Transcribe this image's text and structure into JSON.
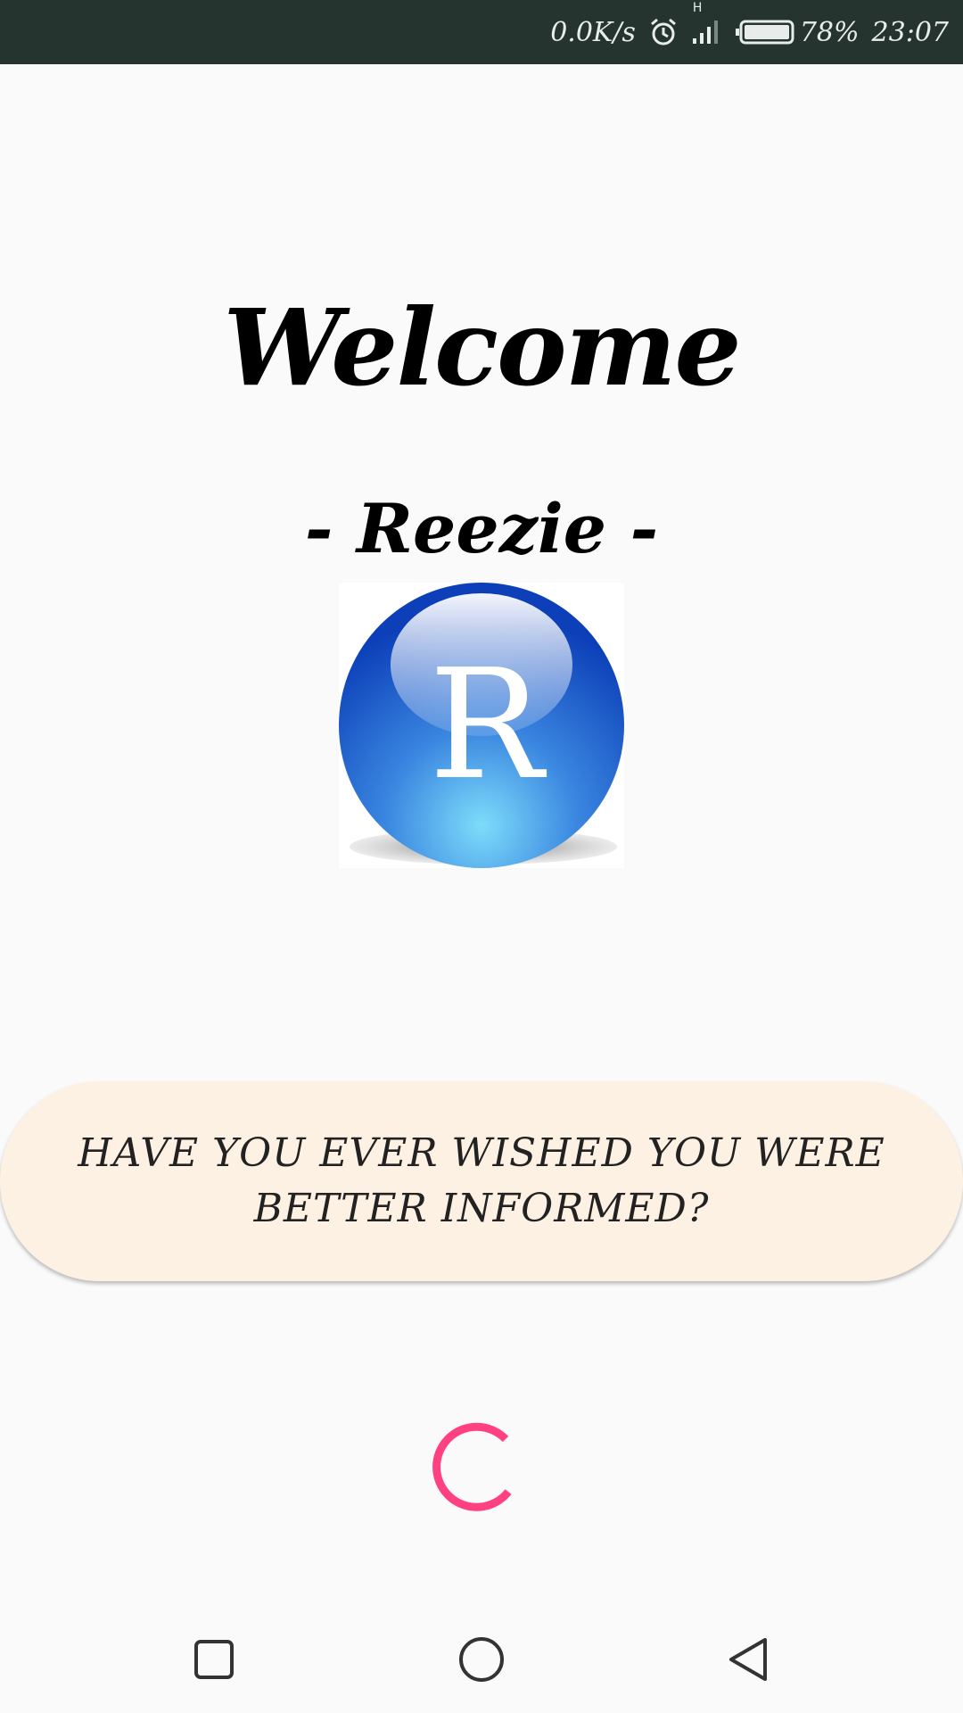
{
  "status_bar": {
    "net_speed": "0.0K/s",
    "network_type": "H",
    "battery_percent": "78%",
    "time": "23:07",
    "battery_level": 0.78,
    "icons": [
      "alarm-icon",
      "signal-icon",
      "battery-icon"
    ]
  },
  "welcome": {
    "title": "Welcome",
    "app_name": "- Reezie -"
  },
  "logo": {
    "letter": "R",
    "icon": "r-sphere-logo"
  },
  "tagline": {
    "text": "HAVE YOU EVER WISHED YOU WERE BETTER INFORMED?"
  },
  "loader": {
    "color": "#ff4081",
    "icon": "loading-spinner"
  },
  "nav": {
    "items": [
      "recent-apps-icon",
      "home-icon",
      "back-icon"
    ]
  },
  "colors": {
    "status_bar_bg": "#263430",
    "card_bg": "#fdf1e3",
    "accent": "#ff4081",
    "logo_blue": "#1a5fd6"
  }
}
